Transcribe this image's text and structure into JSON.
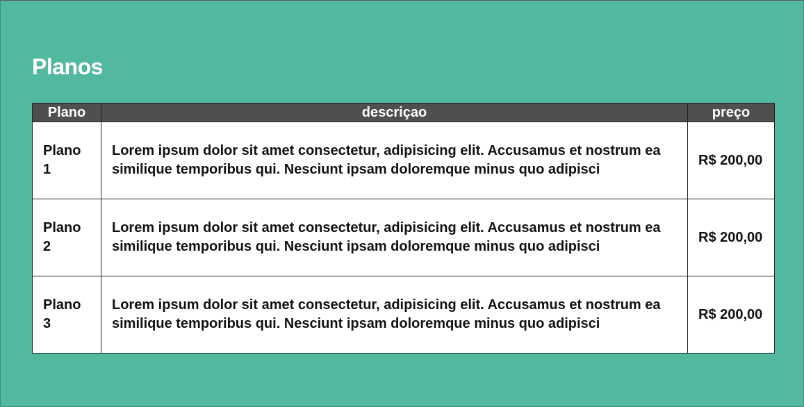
{
  "page": {
    "title": "Planos"
  },
  "table": {
    "headers": [
      "Plano",
      "descriçao",
      "preço"
    ],
    "rows": [
      {
        "plan": "Plano 1",
        "description": "Lorem ipsum dolor sit amet consectetur, adipisicing elit. Accusamus et nostrum ea similique temporibus qui. Nesciunt ipsam doloremque minus quo adipisci",
        "price": "R$ 200,00"
      },
      {
        "plan": "Plano 2",
        "description": "Lorem ipsum dolor sit amet consectetur, adipisicing elit. Accusamus et nostrum ea similique temporibus qui. Nesciunt ipsam doloremque minus quo adipisci",
        "price": "R$ 200,00"
      },
      {
        "plan": "Plano 3",
        "description": "Lorem ipsum dolor sit amet consectetur, adipisicing elit. Accusamus et nostrum ea similique temporibus qui. Nesciunt ipsam doloremque minus quo adipisci",
        "price": "R$ 200,00"
      }
    ]
  },
  "colors": {
    "background": "#52b89e",
    "header_bg": "#4f4f4f",
    "cell_bg": "#ffffff"
  }
}
